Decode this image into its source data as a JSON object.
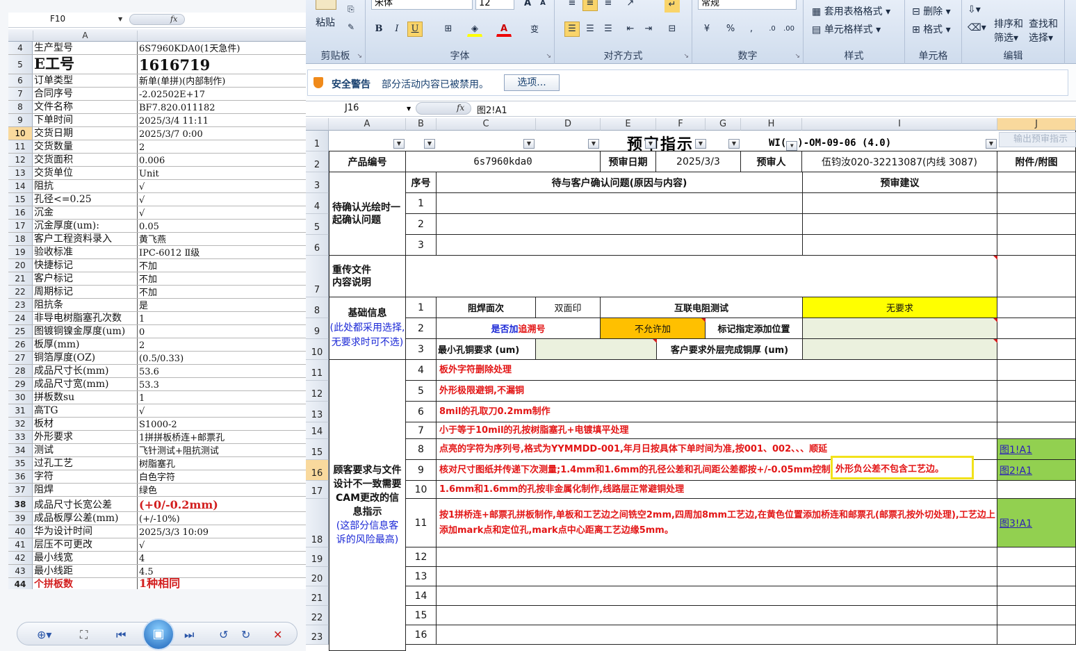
{
  "left": {
    "namebox": "F10",
    "fx": "fx",
    "col_a": "A",
    "rows": [
      {
        "n": "4",
        "k": "生产型号",
        "v": "6S7960KDA0(1天急件)"
      },
      {
        "n": "5",
        "k": "E工号",
        "v": "1616719"
      },
      {
        "n": "6",
        "k": "订单类型",
        "v": "新单(单拼)(内部制作)"
      },
      {
        "n": "7",
        "k": "合同序号",
        "v": "-2.02502E+17"
      },
      {
        "n": "8",
        "k": "文件名称",
        "v": "BF7.820.011182"
      },
      {
        "n": "9",
        "k": "下单时间",
        "v": "2025/3/4 11:11"
      },
      {
        "n": "10",
        "k": "交货日期",
        "v": "2025/3/7 0:00"
      },
      {
        "n": "11",
        "k": "交货数量",
        "v": "2"
      },
      {
        "n": "12",
        "k": "交货面积",
        "v": "0.006"
      },
      {
        "n": "13",
        "k": "交货单位",
        "v": "Unit"
      },
      {
        "n": "14",
        "k": "阻抗",
        "v": "√"
      },
      {
        "n": "15",
        "k": "孔径<=0.25",
        "v": "√"
      },
      {
        "n": "16",
        "k": "沉金",
        "v": "√"
      },
      {
        "n": "17",
        "k": "沉金厚度(um):",
        "v": "0.05"
      },
      {
        "n": "18",
        "k": "客户工程资料录入",
        "v": "黄飞燕"
      },
      {
        "n": "19",
        "k": "验收标准",
        "v": "IPC-6012 Ⅱ级"
      },
      {
        "n": "20",
        "k": "快捷标记",
        "v": "不加"
      },
      {
        "n": "21",
        "k": "客户标记",
        "v": "不加"
      },
      {
        "n": "22",
        "k": "周期标记",
        "v": "不加"
      },
      {
        "n": "23",
        "k": "阻抗条",
        "v": "是"
      },
      {
        "n": "24",
        "k": "非导电树脂塞孔次数",
        "v": "1"
      },
      {
        "n": "25",
        "k": "图镀铜镍金厚度(um)",
        "v": "0"
      },
      {
        "n": "26",
        "k": "板厚(mm)",
        "v": "2"
      },
      {
        "n": "27",
        "k": "铜箔厚度(OZ)",
        "v": "(0.5/0.33)"
      },
      {
        "n": "28",
        "k": "成品尺寸长(mm)",
        "v": "53.6"
      },
      {
        "n": "29",
        "k": "成品尺寸宽(mm)",
        "v": "53.3"
      },
      {
        "n": "30",
        "k": "拼板数su",
        "v": "1"
      },
      {
        "n": "31",
        "k": "高TG",
        "v": "√"
      },
      {
        "n": "32",
        "k": "板材",
        "v": "S1000-2"
      },
      {
        "n": "33",
        "k": "外形要求",
        "v": "1拼拼板桥连+邮票孔"
      },
      {
        "n": "34",
        "k": "测试",
        "v": "飞针测试+阻抗测试"
      },
      {
        "n": "35",
        "k": "过孔工艺",
        "v": "树脂塞孔"
      },
      {
        "n": "36",
        "k": "字符",
        "v": "白色字符"
      },
      {
        "n": "37",
        "k": "阻焊",
        "v": "绿色"
      },
      {
        "n": "38",
        "k": "成品尺寸长宽公差",
        "v": "(+0/-0.2mm)"
      },
      {
        "n": "39",
        "k": "成品板厚公差(mm)",
        "v": "(+/-10%)"
      },
      {
        "n": "40",
        "k": "华为设计时间",
        "v": "2025/3/3 10:09"
      },
      {
        "n": "41",
        "k": "层压不可更改",
        "v": "√"
      },
      {
        "n": "42",
        "k": "最小线宽",
        "v": "4"
      },
      {
        "n": "43",
        "k": "最小线距",
        "v": "4.5"
      },
      {
        "n": "44",
        "k": "个拼板数",
        "v": "1种相同"
      }
    ]
  },
  "ribbon": {
    "paste": "粘贴",
    "font_name": "宋体",
    "font_size": "12",
    "num_format": "常规",
    "groups": {
      "clipboard": "剪贴板",
      "font": "字体",
      "align": "对齐方式",
      "number": "数字",
      "styles": "样式",
      "cells": "单元格",
      "edit": "编辑"
    },
    "table_fmt": "套用表格格式",
    "cell_style": "单元格样式",
    "delete": "删除",
    "format": "格式",
    "sort": "排序和",
    "sort2": "筛选",
    "find": "查找和",
    "find2": "选择"
  },
  "security": {
    "title": "安全警告",
    "msg": "部分活动内容已被禁用。",
    "btn": "选项..."
  },
  "formula": {
    "namebox": "J16",
    "fx": "fx",
    "value": "图2!A1"
  },
  "cols": [
    "A",
    "B",
    "C",
    "D",
    "E",
    "F",
    "G",
    "H",
    "I",
    "J"
  ],
  "rows": [
    "1",
    "2",
    "3",
    "4",
    "5",
    "6",
    "7",
    "8",
    "9",
    "10",
    "11",
    "12",
    "13",
    "14",
    "15",
    "16",
    "17",
    "18",
    "19",
    "20",
    "21",
    "22",
    "23"
  ],
  "sheet": {
    "title": "预审指示",
    "doc_no": "WI(",
    "doc_no2": ")-OM-09-06 (4.0)",
    "export_btn": "输出预审指示",
    "prod_label": "产品编号",
    "prod_val": "6s7960kda0",
    "date_label": "预审日期",
    "date_val": "2025/3/3",
    "person_label": "预审人",
    "person_val": "伍钧汝020-32213087(内线 3087)",
    "attach": "附件/附图",
    "seq": "序号",
    "issues_hdr": "待与客户确认问题(原因与内容)",
    "advice_hdr": "预审建议",
    "sec1": "待确认光绘时一起确认问题",
    "n1": "1",
    "n2": "2",
    "n3": "3",
    "sec2": "重传文件\n内容说明",
    "sec3": "基础信息",
    "sec3b": "(此处都采用选择,无要求时可不选)",
    "r8a": "阻焊面次",
    "r8b": "双面印",
    "r8c": "互联电阻测试",
    "r8d": "无要求",
    "r9a": "是否加",
    "r9a2": "追溯号",
    "r9b": "不允许加",
    "r9c": "标记指定添加位置",
    "r10a": "最小孔铜要求 (um)",
    "r10c": "客户要求外层完成铜厚 (um)",
    "sec4": "顾客要求与文件设计不一致需要CAM更改的信息指示",
    "sec4b": "(这部分信息客诉的风险最高)",
    "items": [
      {
        "n": "4",
        "t": "板外字符删除处理"
      },
      {
        "n": "5",
        "t": "外形极限避铜,不漏铜"
      },
      {
        "n": "6",
        "t": "8mil的孔取刀0.2mm制作"
      },
      {
        "n": "7",
        "t": "小于等于10mil的孔按树脂塞孔+电镀填平处理"
      },
      {
        "n": "8",
        "t": "点亮的字符为序列号,格式为YYMMDD-001,年月日按具体下单时间为准,按001、002、、、顺延",
        "link": "图1!A1"
      },
      {
        "n": "9",
        "t": "核对尺寸图纸并传递下次测量;1.4mm和1.6mm的孔径公差和孔间距公差都按+/-0.05mm控制;",
        "t2": "外形负公差不包含工艺边。",
        "link": "图2!A1"
      },
      {
        "n": "10",
        "t": "1.6mm和1.6mm的孔按非金属化制作,线路层正常避铜处理"
      },
      {
        "n": "11",
        "t": "按1拼桥连+邮票孔拼板制作,单板和工艺边之间铣空2mm,四周加8mm工艺边,在黄色位置添加桥连和邮票孔(邮票孔按外切处理),工艺边上添加mark点和定位孔,mark点中心距离工艺边缘5mm。",
        "link": "图3!A1"
      },
      {
        "n": "12",
        "t": ""
      },
      {
        "n": "13",
        "t": ""
      },
      {
        "n": "14",
        "t": ""
      },
      {
        "n": "15",
        "t": ""
      },
      {
        "n": "16",
        "t": ""
      }
    ]
  },
  "viewer": {
    "zoom_icon": "zoom-icon",
    "play_icon": "slideshow-icon"
  },
  "colors": {
    "yellow": "#ffff00",
    "orange": "#ffc000",
    "green": "#92d050",
    "lightgreen": "#ebf1de",
    "red": "#e31616",
    "blue": "#1b28d6"
  }
}
